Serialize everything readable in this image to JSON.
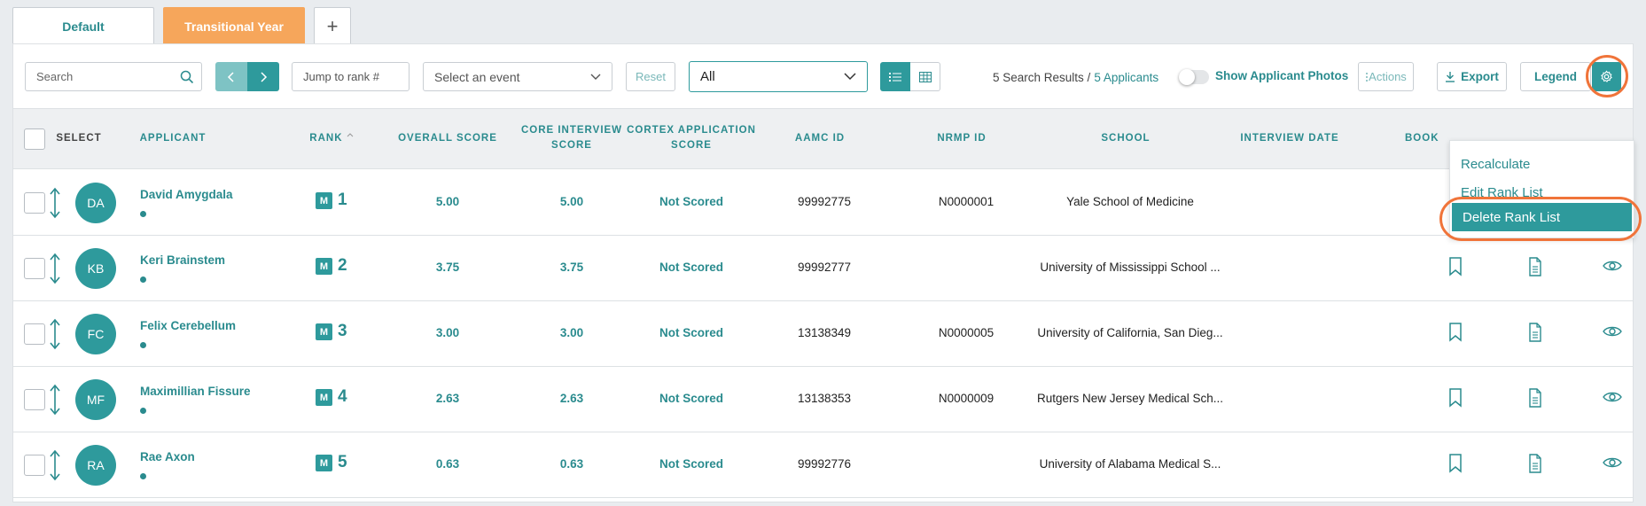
{
  "tabs": [
    {
      "label": "Default",
      "active": false
    },
    {
      "label": "Transitional Year",
      "active": true
    },
    {
      "label": "+"
    }
  ],
  "toolbar": {
    "search_placeholder": "Search",
    "jump_placeholder": "Jump to rank #",
    "event_placeholder": "Select an event",
    "reset_label": "Reset",
    "filter_value": "All",
    "results_text": "5 Search Results /",
    "applicants_text": "5 Applicants",
    "show_photos_label": "Show Applicant Photos",
    "show_photos_on": false,
    "actions_label": "Actions",
    "export_label": "Export",
    "legend_label": "Legend"
  },
  "menu": {
    "items": [
      "Recalculate",
      "Edit Rank List",
      "Delete Rank List"
    ],
    "highlighted": "Delete Rank List"
  },
  "columns": {
    "select": "Select",
    "applicant": "Applicant",
    "rank": "Rank",
    "overall": "Overall Score",
    "core": "Core Interview Score",
    "cortex": "Cortex Application Score",
    "aamc": "AAMC ID",
    "nrmp": "NRMP ID",
    "school": "School",
    "interview": "Interview Date",
    "book": "Book"
  },
  "rows": [
    {
      "initials": "DA",
      "name": "David Amygdala",
      "badge": "M",
      "rank": "1",
      "overall": "5.00",
      "core": "5.00",
      "cortex": "Not Scored",
      "aamc": "99992775",
      "nrmp": "N0000001",
      "school": "Yale School of Medicine"
    },
    {
      "initials": "KB",
      "name": "Keri Brainstem",
      "badge": "M",
      "rank": "2",
      "overall": "3.75",
      "core": "3.75",
      "cortex": "Not Scored",
      "aamc": "99992777",
      "nrmp": "",
      "school": "University of Mississippi School ..."
    },
    {
      "initials": "FC",
      "name": "Felix Cerebellum",
      "badge": "M",
      "rank": "3",
      "overall": "3.00",
      "core": "3.00",
      "cortex": "Not Scored",
      "aamc": "13138349",
      "nrmp": "N0000005",
      "school": "University of California, San Dieg..."
    },
    {
      "initials": "MF",
      "name": "Maximillian Fissure",
      "badge": "M",
      "rank": "4",
      "overall": "2.63",
      "core": "2.63",
      "cortex": "Not Scored",
      "aamc": "13138353",
      "nrmp": "N0000009",
      "school": "Rutgers New Jersey Medical Sch..."
    },
    {
      "initials": "RA",
      "name": "Rae Axon",
      "badge": "M",
      "rank": "5",
      "overall": "0.63",
      "core": "0.63",
      "cortex": "Not Scored",
      "aamc": "99992776",
      "nrmp": "",
      "school": "University of Alabama Medical S..."
    }
  ],
  "colors": {
    "teal": "#2e9a9c",
    "orange": "#f6a65b",
    "highlight_ring": "#f0743a"
  }
}
